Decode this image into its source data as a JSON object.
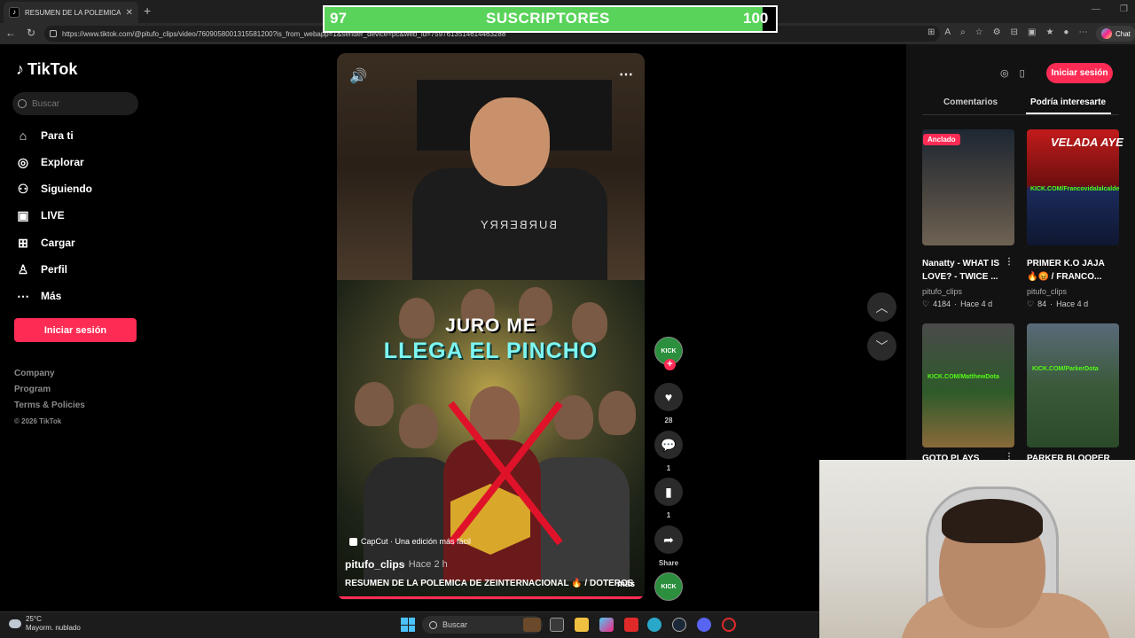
{
  "browser": {
    "tab_title": "RESUMEN DE LA POLEMICA DE ZE",
    "url": "https://www.tiktok.com/@pitufo_clips/video/7609058001315581200?is_from_webapp=1&sender_device=pc&web_id=7597613514614463288",
    "chat_label": "Chat"
  },
  "overlay": {
    "current": "97",
    "label": "SUSCRIPTORES",
    "goal": "100",
    "progress_fraction": 0.97,
    "fill_color": "#5ad35a"
  },
  "sidebar": {
    "logo": "TikTok",
    "search_placeholder": "Buscar",
    "items": [
      {
        "label": "Para ti",
        "icon": "home-icon"
      },
      {
        "label": "Explorar",
        "icon": "compass-icon"
      },
      {
        "label": "Siguiendo",
        "icon": "following-icon"
      },
      {
        "label": "LIVE",
        "icon": "live-icon"
      },
      {
        "label": "Cargar",
        "icon": "upload-icon"
      },
      {
        "label": "Perfil",
        "icon": "profile-icon"
      },
      {
        "label": "Más",
        "icon": "more-icon"
      }
    ],
    "login_button": "Iniciar sesión",
    "footer_links": [
      "Company",
      "Program",
      "Terms & Policies"
    ],
    "copyright": "© 2026 TikTok"
  },
  "video": {
    "cam_text": "BURBERRY",
    "headline1": "JURO ME",
    "headline2": "LLEGA EL PINCHO",
    "capcut": "CapCut · Una edición más fácil",
    "author": "pitufo_clips",
    "time": "· Hace 2 h",
    "caption": "RESUMEN DE LA POLEMICA DE ZEINTERNACIONAL 🔥 / DOTEROS",
    "more": "más"
  },
  "actions": {
    "avatar_label": "KICK",
    "likes": "28",
    "comments": "1",
    "saves": "1",
    "share": "Share"
  },
  "right_panel": {
    "login_button": "Iniciar sesión",
    "tabs": [
      "Comentarios",
      "Podría interesarte"
    ],
    "active_tab": "Podría interesarte",
    "cards": [
      {
        "badge": "Anclado",
        "title1": "Nanatty - WHAT IS",
        "title2": "LOVE? - TWICE ...",
        "author": "pitufo_clips",
        "likes": "4184",
        "time": "Hace 4 d",
        "tag": ""
      },
      {
        "badge": "",
        "title1": "PRIMER K.O JAJA",
        "title2": "🔥😡 / FRANCO...",
        "author": "pitufo_clips",
        "likes": "84",
        "time": "Hace 4 d",
        "tag": "KICK.COM/Francovidalalcalde"
      },
      {
        "badge": "",
        "title1": "GOTO PLAYS",
        "title2": "",
        "author": "",
        "likes": "",
        "time": "",
        "tag": "KICK.COM/MatthewDota"
      },
      {
        "badge": "",
        "title1": "PARKER BLOOPER",
        "title2": "",
        "author": "",
        "likes": "",
        "time": "",
        "tag": "KICK.COM/ParkerDota"
      }
    ],
    "card2_banner": "VELADA AYE"
  },
  "taskbar": {
    "weather_temp": "25°C",
    "weather_desc": "Mayorm. nublado",
    "search": "Buscar"
  }
}
